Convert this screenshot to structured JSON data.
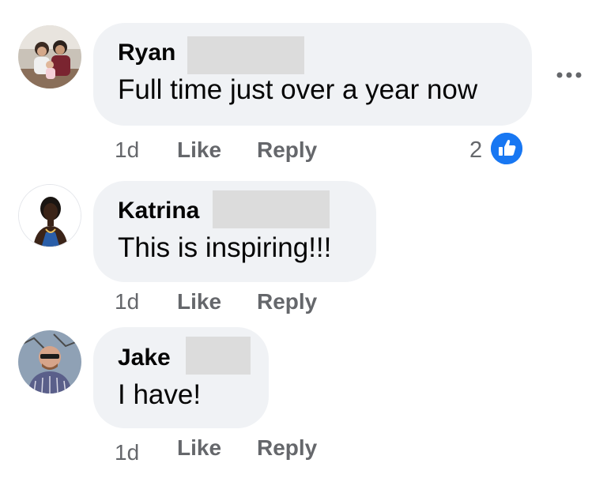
{
  "comments": [
    {
      "author": "Ryan",
      "text": "Full time just over a year now",
      "time": "1d",
      "like_label": "Like",
      "reply_label": "Reply",
      "reaction_count": "2",
      "reaction_icon": "like-thumb-icon",
      "avatar": "family-photo-avatar"
    },
    {
      "author": "Katrina",
      "text": "This is inspiring!!!",
      "time": "1d",
      "like_label": "Like",
      "reply_label": "Reply",
      "avatar": "woman-portrait-avatar"
    },
    {
      "author": "Jake",
      "text": "I have!",
      "time": "1d",
      "like_label": "Like",
      "reply_label": "Reply",
      "avatar": "man-sunglasses-avatar"
    }
  ],
  "more_icon": "more-options-icon",
  "colors": {
    "bubble": "#f0f2f5",
    "meta_text": "#65676b",
    "like_blue": "#1877f2",
    "redaction": "#dcdcdc"
  }
}
